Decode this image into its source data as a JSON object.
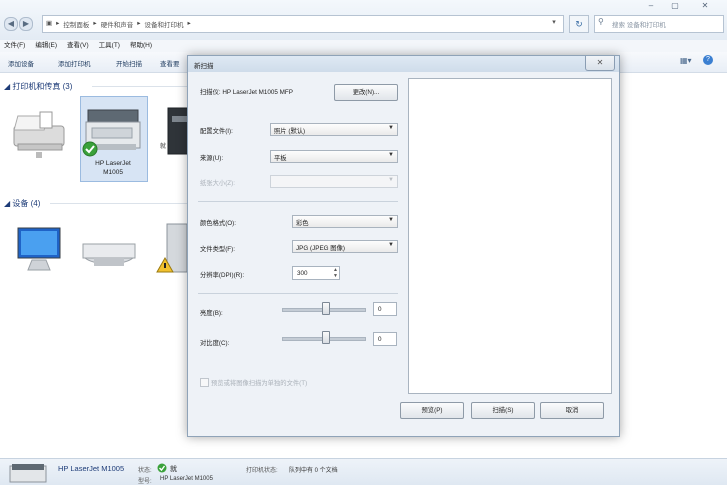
{
  "explorer": {
    "breadcrumbs": [
      "控制面板",
      "硬件和声音",
      "设备和打印机"
    ],
    "search_placeholder": "搜索 设备和打印机",
    "menu": [
      "文件(F)",
      "编辑(E)",
      "查看(V)",
      "工具(T)",
      "帮助(H)"
    ],
    "toolbar": [
      "添加设备",
      "添加打印机",
      "开始扫描",
      "查看要"
    ],
    "printers_section": "打印机和传真 (3)",
    "devices_section": "设备 (4)",
    "selected_printer_label": "HP LaserJet\nM1005",
    "status": {
      "name": "HP LaserJet M1005",
      "state_label": "状态:",
      "state_value": "就",
      "queue_label": "打印机状态:",
      "queue_value": "队列中有 0 个文档",
      "model_label": "型号:",
      "model_value": "HP LaserJet M1005"
    }
  },
  "dialog": {
    "title": "新扫描",
    "close_glyph": "✕",
    "scanner_label": "扫描仪: HP LaserJet M1005 MFP",
    "change_button": "更改(N)...",
    "profile_label": "配置文件(I):",
    "profile_value": "照片 (默认)",
    "source_label": "来源(U):",
    "source_value": "平板",
    "paper_size_label": "纸张大小(Z):",
    "color_format_label": "颜色格式(O):",
    "color_format_value": "彩色",
    "file_type_label": "文件类型(F):",
    "file_type_value": "JPG (JPEG 图像)",
    "resolution_label": "分辨率(DPI)(R):",
    "resolution_value": "300",
    "brightness_label": "亮度(B):",
    "brightness_value": "0",
    "contrast_label": "对比度(C):",
    "contrast_value": "0",
    "checkbox_label": "预览或将图像扫描为单独的文件(T)",
    "preview_button": "预览(P)",
    "scan_button": "扫描(S)",
    "cancel_button": "取消"
  }
}
